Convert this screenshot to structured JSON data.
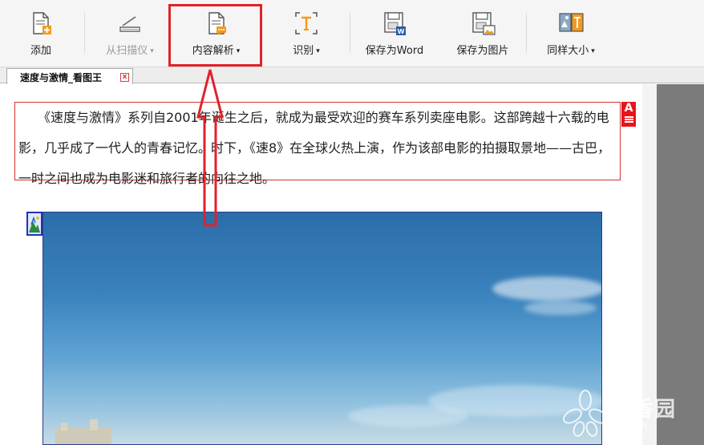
{
  "toolbar": {
    "add_label": "添加",
    "scanner_label": "从扫描仪",
    "analyze_label": "内容解析",
    "recognize_label": "识别",
    "save_word_label": "保存为Word",
    "save_image_label": "保存为图片",
    "same_size_label": "同样大小",
    "caret": "▾"
  },
  "tab": {
    "title": "速度与激情_看图王",
    "close": "x"
  },
  "document": {
    "paragraph": "　　《速度与激情》系列自2001年诞生之后，就成为最受欢迎的赛车系列卖座电影。这部跨越十六载的电影，几乎成了一代人的青春记忆。时下，《速8》在全球火热上演，作为该部电影的拍摄取景地——古巴，一时之间也成为电影迷和旅行者的向往之地。",
    "text_badge": "A"
  },
  "watermark": {
    "name": "丁香园",
    "domain": "DXY.CN"
  },
  "colors": {
    "highlight": "#e0222a",
    "text_region_border": "#d9302f",
    "image_region_border": "#2b3a8c",
    "accent_orange": "#f39a1e"
  }
}
